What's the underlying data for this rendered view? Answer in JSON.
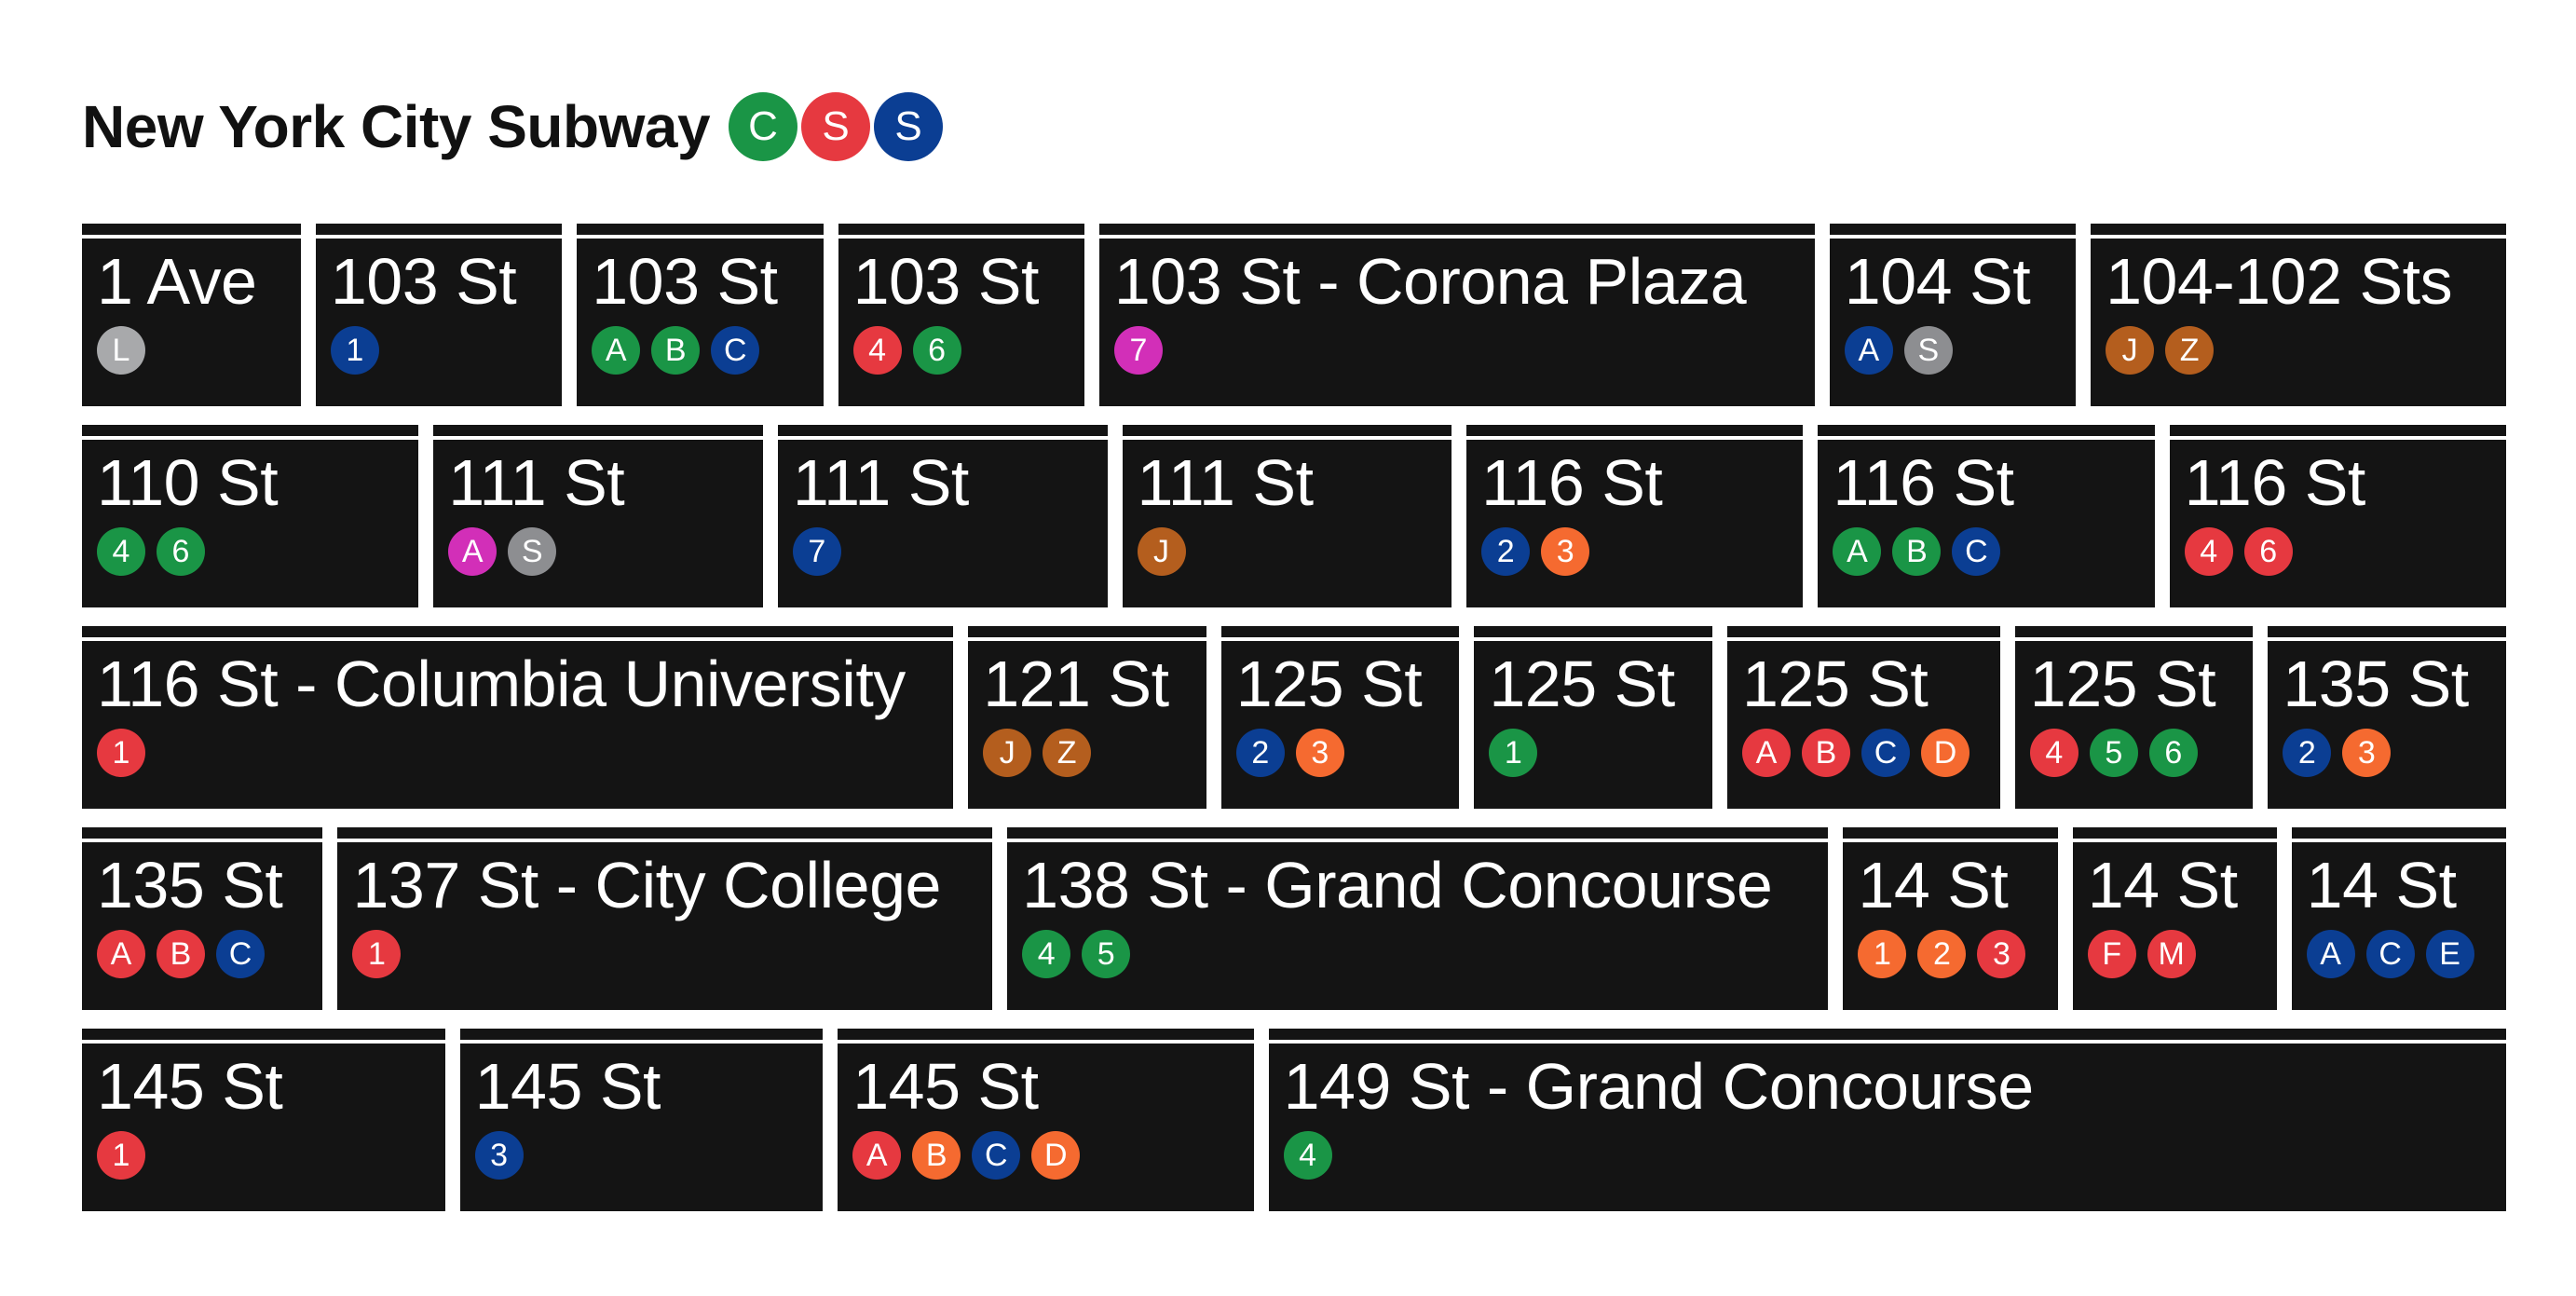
{
  "title": "New York City Subway",
  "title_bullets": [
    {
      "label": "C",
      "color": "#1a9546"
    },
    {
      "label": "S",
      "color": "#e63940"
    },
    {
      "label": "S",
      "color": "#0b3e93"
    }
  ],
  "colors": {
    "sign_bg": "#141414",
    "red": "#e63940",
    "green": "#1a9546",
    "blue": "#0b3e93",
    "orange": "#f56a30",
    "gray": "#8d8e91",
    "lightgray": "#a8a9ab",
    "brown": "#b45e1e",
    "magenta": "#d22fb8"
  },
  "rows": [
    [
      {
        "name": "1 Ave",
        "lines": [
          {
            "label": "L",
            "color": "#a8a9ab"
          }
        ]
      },
      {
        "name": "103 St",
        "lines": [
          {
            "label": "1",
            "color": "#0b3e93"
          }
        ]
      },
      {
        "name": "103 St",
        "lines": [
          {
            "label": "A",
            "color": "#1a9546"
          },
          {
            "label": "B",
            "color": "#1a9546"
          },
          {
            "label": "C",
            "color": "#0b3e93"
          }
        ]
      },
      {
        "name": "103 St",
        "lines": [
          {
            "label": "4",
            "color": "#e63940"
          },
          {
            "label": "6",
            "color": "#1a9546"
          }
        ]
      },
      {
        "name": "103 St - Corona Plaza",
        "lines": [
          {
            "label": "7",
            "color": "#d22fb8"
          }
        ]
      },
      {
        "name": "104 St",
        "lines": [
          {
            "label": "A",
            "color": "#0b3e93"
          },
          {
            "label": "S",
            "color": "#8d8e91"
          }
        ]
      },
      {
        "name": "104-102 Sts",
        "lines": [
          {
            "label": "J",
            "color": "#b45e1e"
          },
          {
            "label": "Z",
            "color": "#b45e1e"
          }
        ]
      }
    ],
    [
      {
        "name": "110 St",
        "lines": [
          {
            "label": "4",
            "color": "#1a9546"
          },
          {
            "label": "6",
            "color": "#1a9546"
          }
        ]
      },
      {
        "name": "111 St",
        "lines": [
          {
            "label": "A",
            "color": "#d22fb8"
          },
          {
            "label": "S",
            "color": "#8d8e91"
          }
        ]
      },
      {
        "name": "111 St",
        "lines": [
          {
            "label": "7",
            "color": "#0b3e93"
          }
        ]
      },
      {
        "name": "111 St",
        "lines": [
          {
            "label": "J",
            "color": "#b45e1e"
          }
        ]
      },
      {
        "name": "116 St",
        "lines": [
          {
            "label": "2",
            "color": "#0b3e93"
          },
          {
            "label": "3",
            "color": "#f56a30"
          }
        ]
      },
      {
        "name": "116 St",
        "lines": [
          {
            "label": "A",
            "color": "#1a9546"
          },
          {
            "label": "B",
            "color": "#1a9546"
          },
          {
            "label": "C",
            "color": "#0b3e93"
          }
        ]
      },
      {
        "name": "116 St",
        "lines": [
          {
            "label": "4",
            "color": "#e63940"
          },
          {
            "label": "6",
            "color": "#e63940"
          }
        ]
      }
    ],
    [
      {
        "name": "116 St - Columbia University",
        "lines": [
          {
            "label": "1",
            "color": "#e63940"
          }
        ]
      },
      {
        "name": "121 St",
        "lines": [
          {
            "label": "J",
            "color": "#b45e1e"
          },
          {
            "label": "Z",
            "color": "#b45e1e"
          }
        ]
      },
      {
        "name": "125 St",
        "lines": [
          {
            "label": "2",
            "color": "#0b3e93"
          },
          {
            "label": "3",
            "color": "#f56a30"
          }
        ]
      },
      {
        "name": "125 St",
        "lines": [
          {
            "label": "1",
            "color": "#1a9546"
          }
        ]
      },
      {
        "name": "125 St",
        "lines": [
          {
            "label": "A",
            "color": "#e63940"
          },
          {
            "label": "B",
            "color": "#e63940"
          },
          {
            "label": "C",
            "color": "#0b3e93"
          },
          {
            "label": "D",
            "color": "#f56a30"
          }
        ]
      },
      {
        "name": "125 St",
        "lines": [
          {
            "label": "4",
            "color": "#e63940"
          },
          {
            "label": "5",
            "color": "#1a9546"
          },
          {
            "label": "6",
            "color": "#1a9546"
          }
        ]
      },
      {
        "name": "135 St",
        "lines": [
          {
            "label": "2",
            "color": "#0b3e93"
          },
          {
            "label": "3",
            "color": "#f56a30"
          }
        ]
      }
    ],
    [
      {
        "name": "135 St",
        "lines": [
          {
            "label": "A",
            "color": "#e63940"
          },
          {
            "label": "B",
            "color": "#e63940"
          },
          {
            "label": "C",
            "color": "#0b3e93"
          }
        ]
      },
      {
        "name": "137 St - City College",
        "lines": [
          {
            "label": "1",
            "color": "#e63940"
          }
        ]
      },
      {
        "name": "138 St - Grand Concourse",
        "lines": [
          {
            "label": "4",
            "color": "#1a9546"
          },
          {
            "label": "5",
            "color": "#1a9546"
          }
        ]
      },
      {
        "name": "14 St",
        "lines": [
          {
            "label": "1",
            "color": "#f56a30"
          },
          {
            "label": "2",
            "color": "#f56a30"
          },
          {
            "label": "3",
            "color": "#e63940"
          }
        ]
      },
      {
        "name": "14 St",
        "lines": [
          {
            "label": "F",
            "color": "#e63940"
          },
          {
            "label": "M",
            "color": "#e63940"
          }
        ]
      },
      {
        "name": "14 St",
        "lines": [
          {
            "label": "A",
            "color": "#0b3e93"
          },
          {
            "label": "C",
            "color": "#0b3e93"
          },
          {
            "label": "E",
            "color": "#0b3e93"
          }
        ]
      }
    ],
    [
      {
        "name": "145 St",
        "lines": [
          {
            "label": "1",
            "color": "#e63940"
          }
        ]
      },
      {
        "name": "145 St",
        "lines": [
          {
            "label": "3",
            "color": "#0b3e93"
          }
        ]
      },
      {
        "name": "145 St",
        "lines": [
          {
            "label": "A",
            "color": "#e63940"
          },
          {
            "label": "B",
            "color": "#f56a30"
          },
          {
            "label": "C",
            "color": "#0b3e93"
          },
          {
            "label": "D",
            "color": "#f56a30"
          }
        ]
      },
      {
        "name": "149 St - Grand Concourse",
        "lines": [
          {
            "label": "4",
            "color": "#1a9546"
          }
        ]
      }
    ]
  ]
}
